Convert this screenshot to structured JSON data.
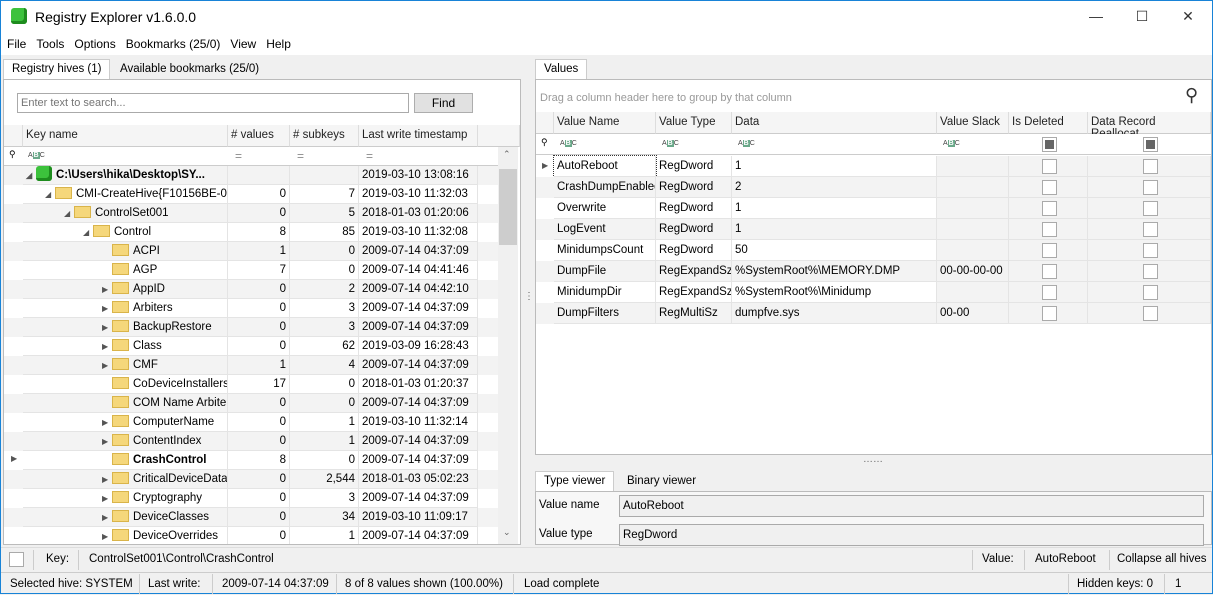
{
  "app": {
    "title": "Registry Explorer v1.6.0.0"
  },
  "menu": [
    "File",
    "Tools",
    "Options",
    "Bookmarks (25/0)",
    "View",
    "Help"
  ],
  "left_tabs": [
    "Registry hives (1)",
    "Available bookmarks (25/0)"
  ],
  "search": {
    "placeholder": "Enter text to search...",
    "button": "Find"
  },
  "tree": {
    "columns": [
      "Key name",
      "# values",
      "# subkeys",
      "Last write timestamp"
    ],
    "rows": [
      {
        "name": "C:\\Users\\hika\\Desktop\\SY...",
        "level": 0,
        "exp": "open",
        "values": "",
        "subkeys": "",
        "ts": "2019-03-10 13:08:16",
        "hive": true
      },
      {
        "name": "CMI-CreateHive{F10156BE-0...",
        "level": 1,
        "exp": "open",
        "values": "0",
        "subkeys": "7",
        "ts": "2019-03-10 11:32:03"
      },
      {
        "name": "ControlSet001",
        "level": 2,
        "exp": "open",
        "values": "0",
        "subkeys": "5",
        "ts": "2018-01-03 01:20:06"
      },
      {
        "name": "Control",
        "level": 3,
        "exp": "open",
        "values": "8",
        "subkeys": "85",
        "ts": "2019-03-10 11:32:08"
      },
      {
        "name": "ACPI",
        "level": 4,
        "exp": "",
        "values": "1",
        "subkeys": "0",
        "ts": "2009-07-14 04:37:09"
      },
      {
        "name": "AGP",
        "level": 4,
        "exp": "",
        "values": "7",
        "subkeys": "0",
        "ts": "2009-07-14 04:41:46"
      },
      {
        "name": "AppID",
        "level": 4,
        "exp": "closed",
        "values": "0",
        "subkeys": "2",
        "ts": "2009-07-14 04:42:10"
      },
      {
        "name": "Arbiters",
        "level": 4,
        "exp": "closed",
        "values": "0",
        "subkeys": "3",
        "ts": "2009-07-14 04:37:09"
      },
      {
        "name": "BackupRestore",
        "level": 4,
        "exp": "closed",
        "values": "0",
        "subkeys": "3",
        "ts": "2009-07-14 04:37:09"
      },
      {
        "name": "Class",
        "level": 4,
        "exp": "closed",
        "values": "0",
        "subkeys": "62",
        "ts": "2019-03-09 16:28:43"
      },
      {
        "name": "CMF",
        "level": 4,
        "exp": "closed",
        "values": "1",
        "subkeys": "4",
        "ts": "2009-07-14 04:37:09"
      },
      {
        "name": "CoDeviceInstallers",
        "level": 4,
        "exp": "",
        "values": "17",
        "subkeys": "0",
        "ts": "2018-01-03 01:20:37"
      },
      {
        "name": "COM Name Arbiter",
        "level": 4,
        "exp": "",
        "values": "0",
        "subkeys": "0",
        "ts": "2009-07-14 04:37:09"
      },
      {
        "name": "ComputerName",
        "level": 4,
        "exp": "closed",
        "values": "0",
        "subkeys": "1",
        "ts": "2019-03-10 11:32:14"
      },
      {
        "name": "ContentIndex",
        "level": 4,
        "exp": "closed",
        "values": "0",
        "subkeys": "1",
        "ts": "2009-07-14 04:37:09"
      },
      {
        "name": "CrashControl",
        "level": 4,
        "exp": "",
        "values": "8",
        "subkeys": "0",
        "ts": "2009-07-14 04:37:09",
        "selected": true
      },
      {
        "name": "CriticalDeviceDatabase",
        "level": 4,
        "exp": "closed",
        "values": "0",
        "subkeys": "2,544",
        "ts": "2018-01-03 05:02:23"
      },
      {
        "name": "Cryptography",
        "level": 4,
        "exp": "closed",
        "values": "0",
        "subkeys": "3",
        "ts": "2009-07-14 04:37:09"
      },
      {
        "name": "DeviceClasses",
        "level": 4,
        "exp": "closed",
        "values": "0",
        "subkeys": "34",
        "ts": "2019-03-10 11:09:17"
      },
      {
        "name": "DeviceOverrides",
        "level": 4,
        "exp": "closed",
        "values": "0",
        "subkeys": "1",
        "ts": "2009-07-14 04:37:09"
      }
    ]
  },
  "values_tab": "Values",
  "group_hint": "Drag a column header here to group by that column",
  "values": {
    "columns": [
      "Value Name",
      "Value Type",
      "Data",
      "Value Slack",
      "Is Deleted",
      "Data Record Reallocat..."
    ],
    "rows": [
      [
        "AutoReboot",
        "RegDword",
        "1",
        ""
      ],
      [
        "CrashDumpEnabled",
        "RegDword",
        "2",
        ""
      ],
      [
        "Overwrite",
        "RegDword",
        "1",
        ""
      ],
      [
        "LogEvent",
        "RegDword",
        "1",
        ""
      ],
      [
        "MinidumpsCount",
        "RegDword",
        "50",
        ""
      ],
      [
        "DumpFile",
        "RegExpandSz",
        "%SystemRoot%\\MEMORY.DMP",
        "00-00-00-00"
      ],
      [
        "MinidumpDir",
        "RegExpandSz",
        "%SystemRoot%\\Minidump",
        ""
      ],
      [
        "DumpFilters",
        "RegMultiSz",
        "dumpfve.sys",
        "00-00"
      ]
    ]
  },
  "viewer_tabs": [
    "Type viewer",
    "Binary viewer"
  ],
  "viewer": {
    "name_label": "Value name",
    "name": "AutoReboot",
    "type_label": "Value type",
    "type": "RegDword"
  },
  "statusbar1": {
    "key_label": "Key:",
    "key": "ControlSet001\\Control\\CrashControl",
    "value_label": "Value:",
    "value": "AutoReboot",
    "collapse": "Collapse all hives"
  },
  "statusbar2": {
    "hive": "Selected hive: SYSTEM",
    "lw_label": "Last write:",
    "lw": "2009-07-14 04:37:09",
    "shown": "8 of 8 values shown (100.00%)",
    "load": "Load complete",
    "hidden": "Hidden keys: 0",
    "count": "1"
  }
}
